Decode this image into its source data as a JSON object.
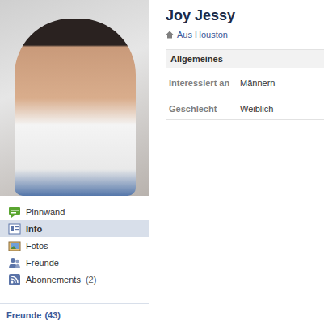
{
  "profile": {
    "name": "Joy Jessy",
    "hometown": "Aus Houston"
  },
  "nav": [
    {
      "label": "Pinnwand",
      "count": "",
      "selected": false
    },
    {
      "label": "Info",
      "count": "",
      "selected": true
    },
    {
      "label": "Fotos",
      "count": "",
      "selected": false
    },
    {
      "label": "Freunde",
      "count": "",
      "selected": false
    },
    {
      "label": "Abonnements",
      "count": "(2)",
      "selected": false
    }
  ],
  "friends": {
    "label": "Freunde",
    "count": "(43)"
  },
  "info": {
    "title": "Allgemeines",
    "rows": [
      {
        "label": "Interessiert an",
        "value": "Männern"
      },
      {
        "label": "Geschlecht",
        "value": "Weiblich"
      }
    ]
  }
}
